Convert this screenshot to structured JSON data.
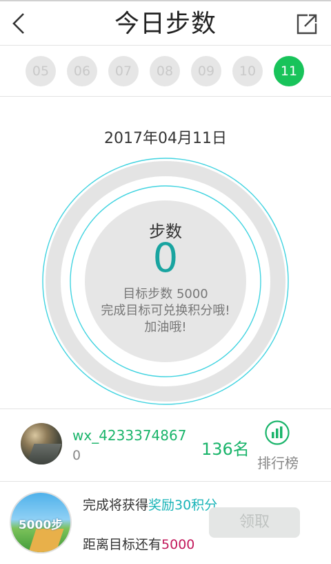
{
  "header": {
    "title": "今日步数",
    "back_icon": "chevron-left-icon",
    "share_icon": "share-external-icon"
  },
  "days": [
    {
      "label": "05",
      "active": false
    },
    {
      "label": "06",
      "active": false
    },
    {
      "label": "07",
      "active": false
    },
    {
      "label": "08",
      "active": false
    },
    {
      "label": "09",
      "active": false
    },
    {
      "label": "10",
      "active": false
    },
    {
      "label": "11",
      "active": true
    }
  ],
  "date": "2017年04月11日",
  "progress": {
    "steps_label": "步数",
    "steps_value": "0",
    "goal_text": "目标步数 5000",
    "hint_line1": "完成目标可兑换积分哦!",
    "hint_line2": "加油哦!",
    "progress_fraction": 0
  },
  "user": {
    "name": "wx_4233374867",
    "steps": "0",
    "rank": "136名",
    "leaderboard_label": "排行榜"
  },
  "reward": {
    "badge_text": "5000步",
    "line_prefix": "完成将获得",
    "line_accent": "奖励30积分",
    "remain_prefix": "距离目标还有",
    "remain_value": "5000",
    "claim_label": "领取"
  },
  "colors": {
    "accent_green": "#18c35a",
    "teal": "#19a4a0",
    "ring_cyan": "#3fd3e0",
    "magenta": "#c2185b"
  }
}
